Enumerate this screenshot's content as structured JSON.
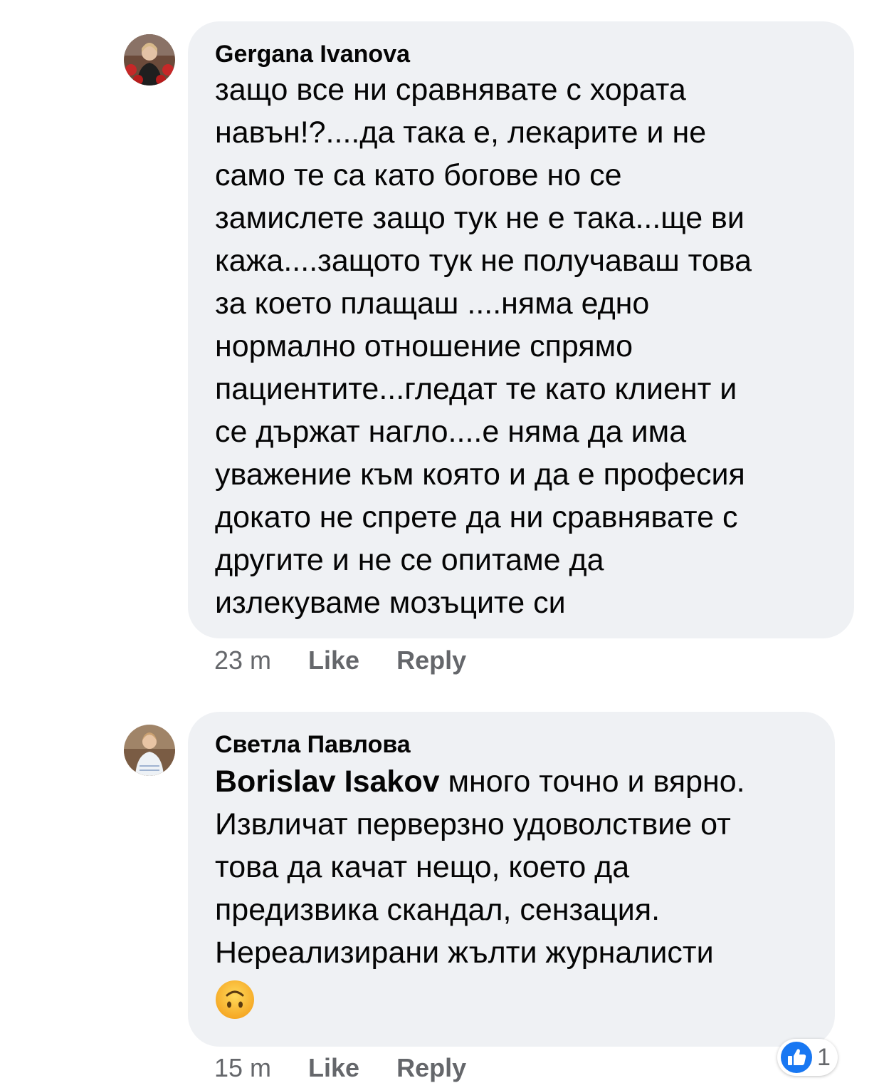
{
  "comments": [
    {
      "author": "Gergana Ivanova",
      "text": "защо все ни сравнявате с хората\nнавън!?....да така е, лекарите и не\nсамо те са като богове но се\nзамислете защо тук не е така...ще ви\nкажа....защото тук не получаваш това\nза което плащаш ....няма едно\nнормално отношение спрямо\nпациентите...гледат те като клиент и\nсе държат нагло....е няма да има\nуважение към която и да е професия\nдокато не спрете да ни сравнявате с\nдругите и не се опитаме да\nизлекуваме  мозъците си",
      "time": "23 m",
      "like_label": "Like",
      "reply_label": "Reply"
    },
    {
      "author": "Светла Павлова",
      "mention": "Borislav Isakov",
      "text": " много точно и вярно.\nИзвличат перверзно удоволствие от\nтова да качат нещо, което да\nпредизвика скандал, сензация.\nНереализирани жълти журналисти",
      "emoji_icon": "upside-down-face-emoji",
      "time": "15 m",
      "like_label": "Like",
      "reply_label": "Reply",
      "reaction_icon": "like-thumb-icon",
      "reaction_count": "1"
    }
  ],
  "colors": {
    "bubble": "#eff1f4",
    "meta_text": "#65676b",
    "like_blue": "#1877f2"
  }
}
